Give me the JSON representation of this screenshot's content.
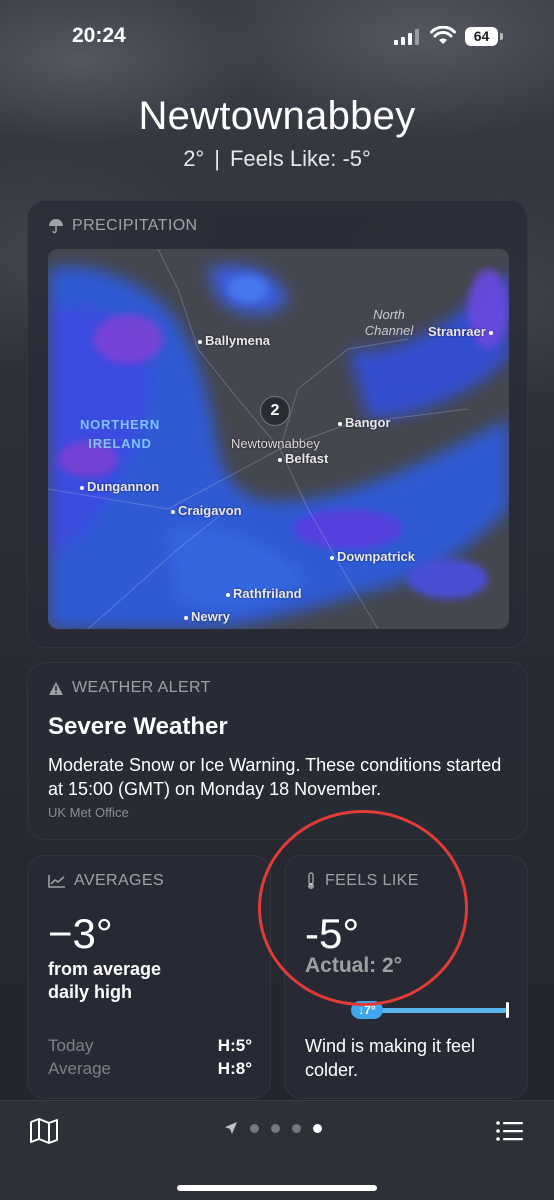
{
  "status_bar": {
    "time": "20:24",
    "battery": "64"
  },
  "location": {
    "city": "Newtownabbey",
    "temperature": "2°",
    "separator": "|",
    "feels_like_text": "Feels Like: -5°"
  },
  "precipitation": {
    "header": "PRECIPITATION",
    "icon": "umbrella-icon",
    "map": {
      "places": [
        "Ballymena",
        "Bangor",
        "Newtownabbey",
        "Belfast",
        "Dungannon",
        "Craigavon",
        "Downpatrick",
        "Rathfriland",
        "Newry",
        "Stranraer"
      ],
      "sea_label_1": "North",
      "sea_label_2": "Channel",
      "region_label_1": "NORTHERN",
      "region_label_2": "IRELAND",
      "marker_count": "2"
    }
  },
  "weather_alert": {
    "header": "WEATHER ALERT",
    "icon": "warning-icon",
    "title": "Severe Weather",
    "body": "Moderate Snow or Ice Warning. These conditions started at 15:00 (GMT) on Monday 18 November.",
    "source": "UK Met Office"
  },
  "averages": {
    "header": "AVERAGES",
    "icon": "trend-chart-icon",
    "value": "−3°",
    "description_line1": "from average",
    "description_line2": "daily high",
    "rows": [
      {
        "label": "Today",
        "value": "H:5°"
      },
      {
        "label": "Average",
        "value": "H:8°"
      }
    ]
  },
  "feels_like": {
    "header": "FEELS LIKE",
    "icon": "thermometer-icon",
    "value": "-5°",
    "actual": "Actual: 2°",
    "scale_badge": "↓7°",
    "description": "Wind is making it feel colder."
  },
  "bottom_bar": {
    "map_icon": "map-icon",
    "location_icon": "location-arrow-icon",
    "page_count": 4,
    "active_page": 4,
    "list_icon": "list-icon"
  },
  "colors": {
    "annotation_circle": "#e23b35",
    "scale_blue": "#5ab7f0",
    "region_label": "#7ec2ff"
  }
}
